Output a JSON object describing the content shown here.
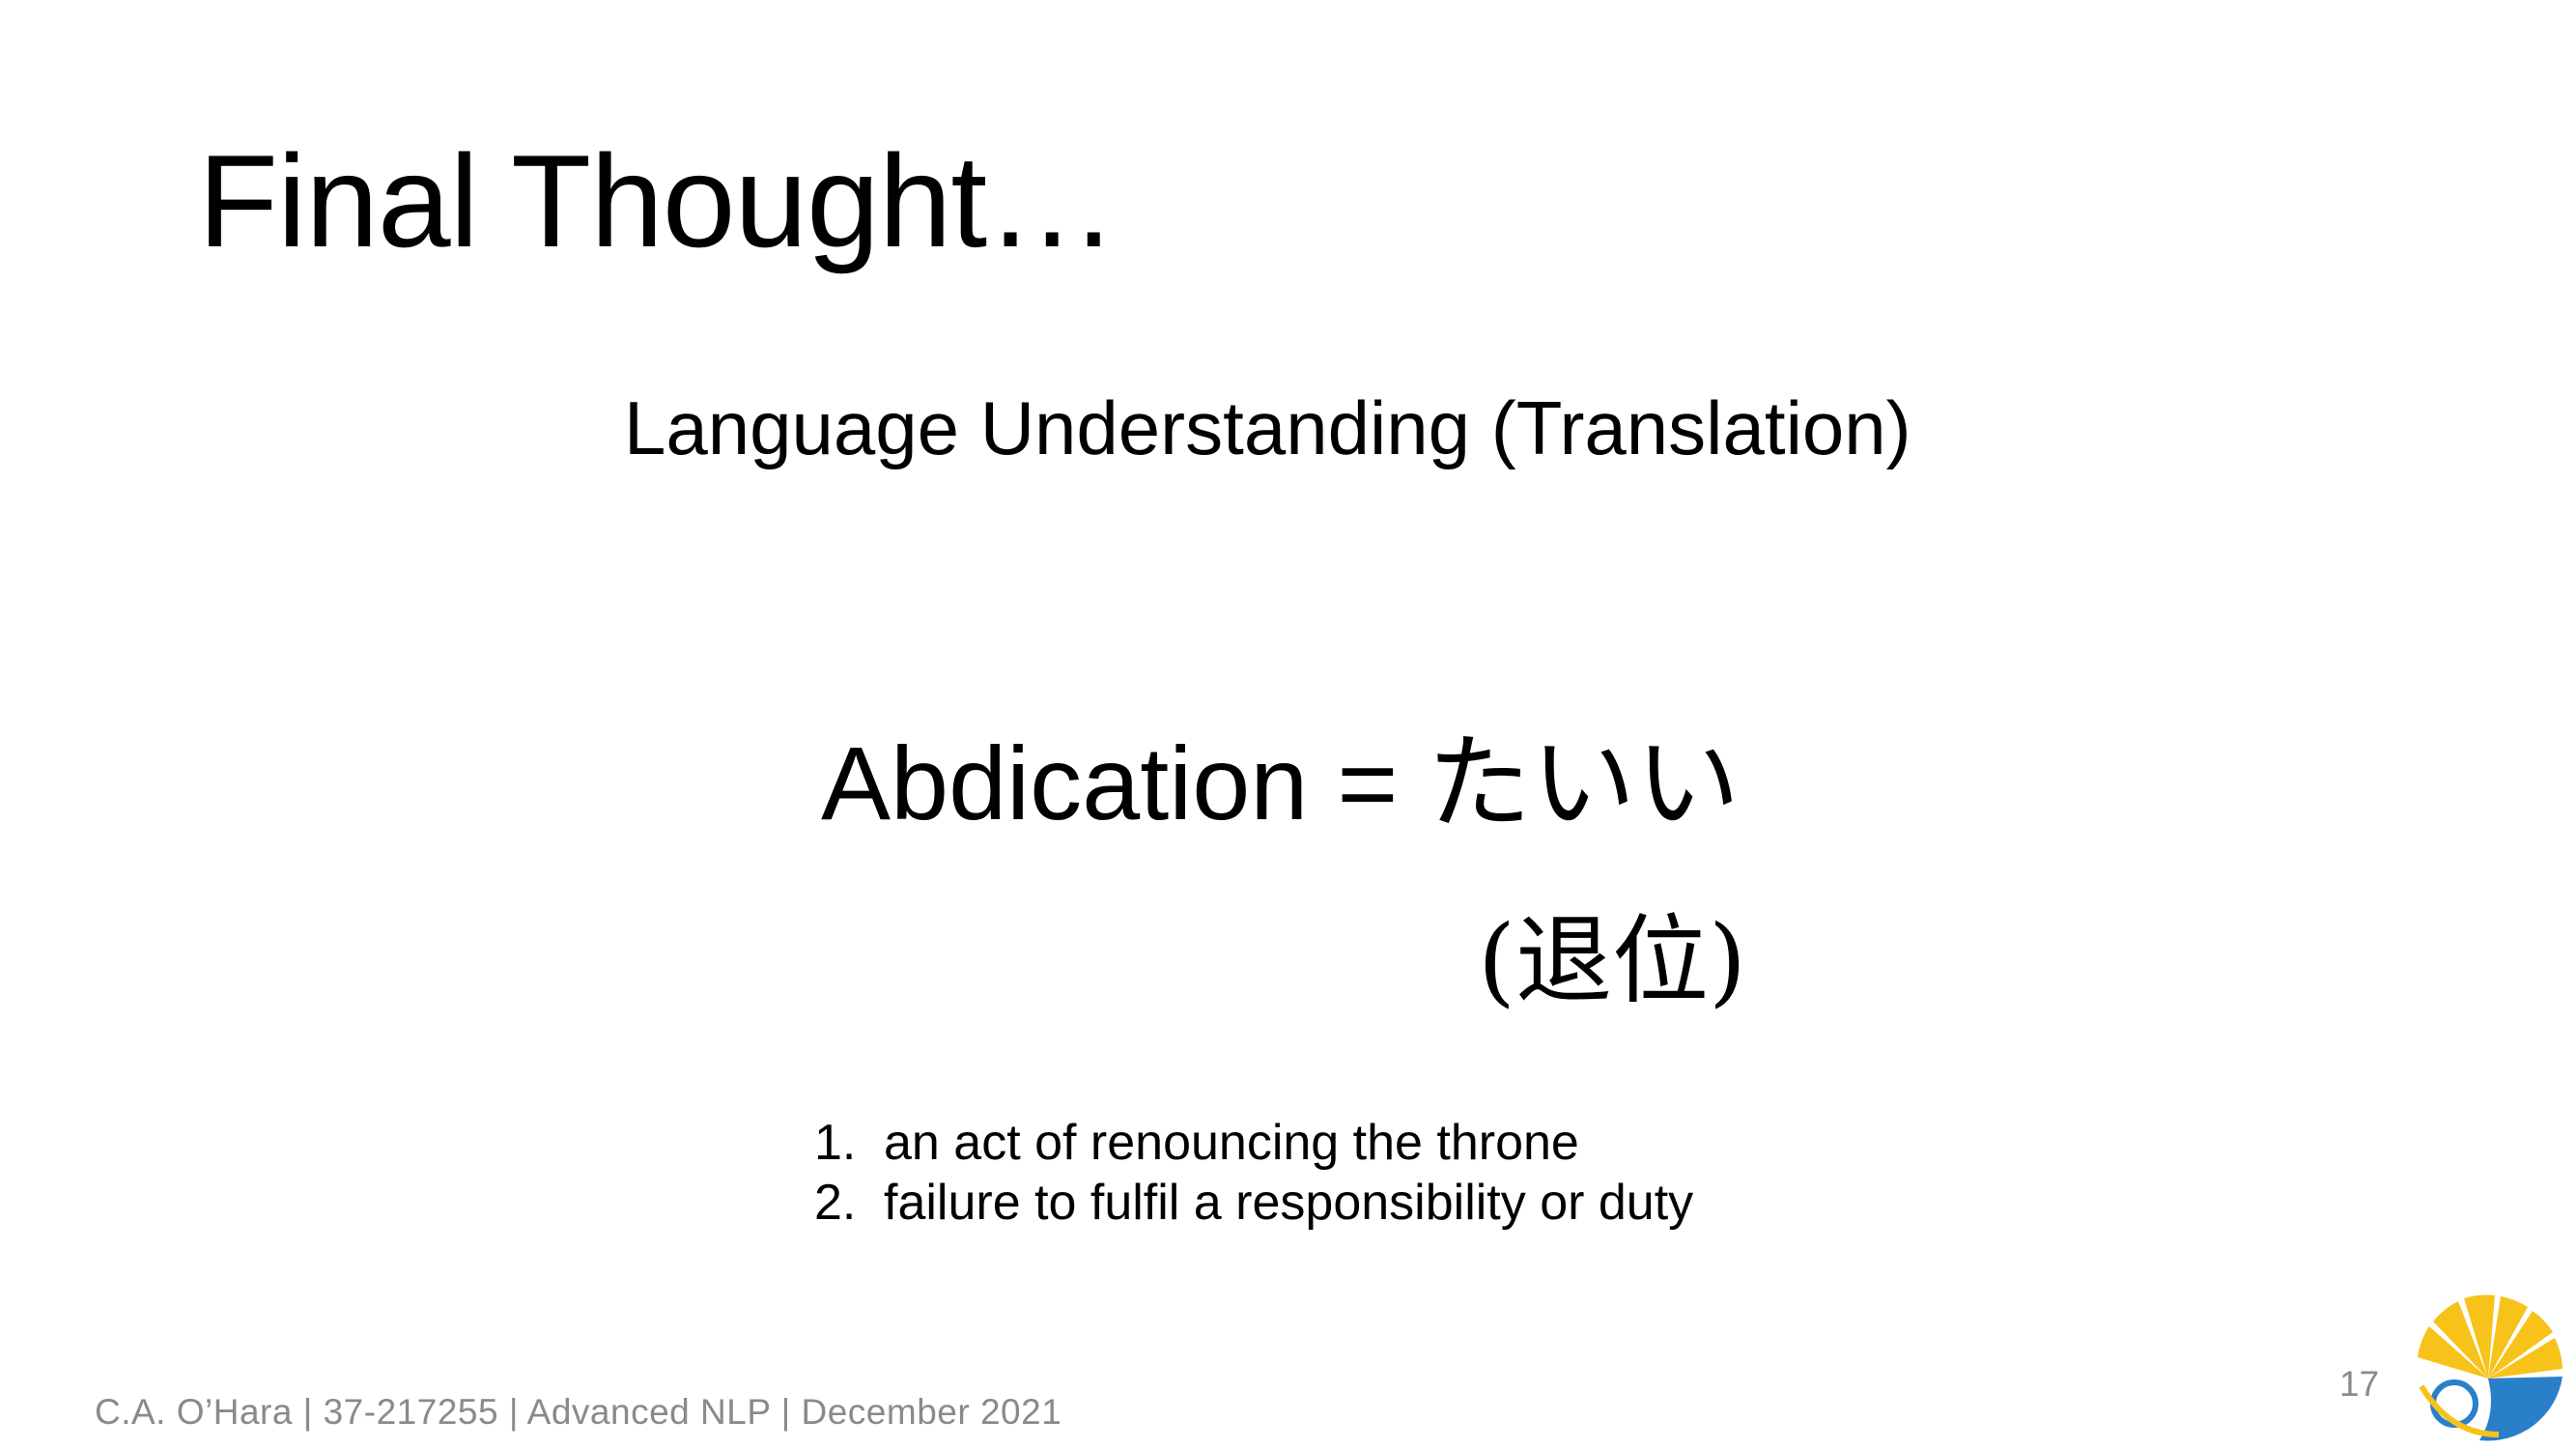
{
  "slide": {
    "title": "Final Thought…",
    "subtitle": "Language Understanding (Translation)",
    "term": {
      "english": "Abdication",
      "equals": "=",
      "japanese_kana": "たいい",
      "japanese_kanji": "(退位)"
    },
    "definitions": [
      {
        "number": "1.",
        "text": "an act of renouncing the throne"
      },
      {
        "number": "2.",
        "text": "failure to fulfil a responsibility or duty"
      }
    ],
    "footer": "C.A. O’Hara | 37-217255 | Advanced NLP | December 2021",
    "page_number": "17",
    "logo_icon": "ginkgo-leaf-logo-icon",
    "colors": {
      "logo_yellow": "#f7c31a",
      "logo_blue": "#2a7fc9",
      "footer_gray": "#8a8a8a"
    }
  }
}
